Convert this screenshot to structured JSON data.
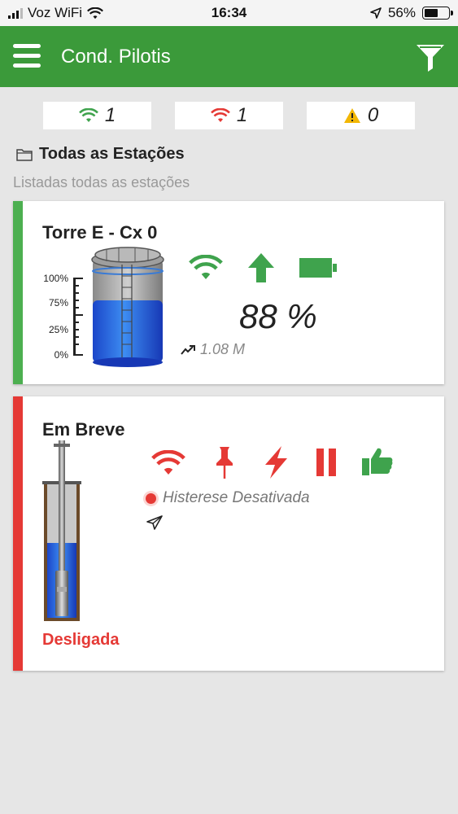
{
  "status_bar": {
    "carrier": "Voz WiFi",
    "time": "16:34",
    "battery": "56%",
    "battery_level": 0.56
  },
  "header": {
    "title": "Cond. Pilotis"
  },
  "counters": {
    "online": "1",
    "offline": "1",
    "alerts": "0"
  },
  "section": {
    "title": "Todas as Estações",
    "subtitle": "Listadas todas as estações"
  },
  "stations": [
    {
      "name": "Torre E - Cx 0",
      "status_color": "#4caf50",
      "scale": [
        "100%",
        "75%",
        "25%",
        "0%"
      ],
      "level_percent": "88 %",
      "volume": "1.08 M",
      "icons": [
        "wifi-icon",
        "arrow-up-icon",
        "battery-icon"
      ]
    },
    {
      "name": "Em Breve",
      "status_color": "#e53935",
      "hysteresis": "Histerese Desativada",
      "state": "Desligada",
      "icons": [
        "wifi-icon",
        "pin-icon",
        "lightning-icon",
        "pause-icon",
        "thumbs-up-icon",
        "send-icon"
      ]
    }
  ],
  "colors": {
    "brand_green": "#3b9a3a",
    "online_green": "#3fa34d",
    "alert_red": "#e53935",
    "warning_yellow": "#f2b705"
  }
}
